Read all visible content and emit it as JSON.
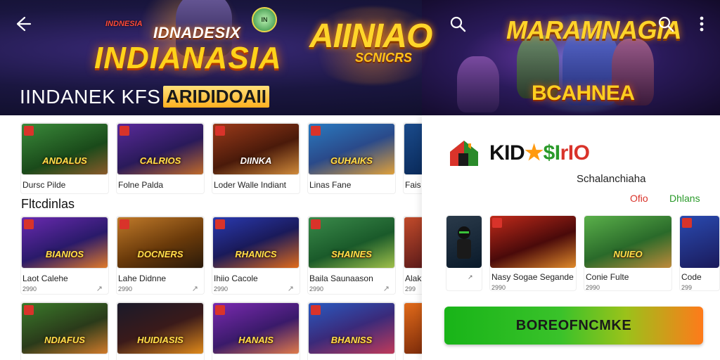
{
  "banner": {
    "logo_small": "INDNESIA",
    "logo_badge": "IN",
    "logo_top": "IDNADESIX",
    "logo_main": "INDIANASIA",
    "logo_aux_1": "AIINIAO",
    "logo_aux_2": "SCNICRS",
    "logo_right_1": "MARAMNAGIA",
    "logo_right_2": "BCAHNEA",
    "caption": "IINDANEK KFS",
    "caption_accent": "ARIDIDOAII"
  },
  "grid": {
    "row1": [
      {
        "thumb": "ANDALUS",
        "label": "Dursc Pilde",
        "sub": ""
      },
      {
        "thumb": "CALRIOS",
        "label": "Folne Palda",
        "sub": ""
      },
      {
        "thumb": "DIINKA",
        "label": "Loder Walle Indiant",
        "sub": ""
      },
      {
        "thumb": "GUHAIKS",
        "label": "Linas Fane",
        "sub": ""
      },
      {
        "thumb": "",
        "label": "Fais",
        "sub": ""
      }
    ],
    "section_title": "Fltcdinlas",
    "row2": [
      {
        "thumb": "BIANIOS",
        "label": "Laot Calehe",
        "sub": "2990"
      },
      {
        "thumb": "DOCNERS",
        "label": "Lahe Didnne",
        "sub": "2990"
      },
      {
        "thumb": "RHANICS",
        "label": "Ihiio Cacole",
        "sub": "2990"
      },
      {
        "thumb": "SHAINES",
        "label": "Baila Saunaason",
        "sub": "2990"
      },
      {
        "thumb": "",
        "label": "Alak",
        "sub": "299"
      }
    ],
    "row3": [
      {
        "thumb": "NDIAFUS",
        "label": "",
        "sub": ""
      },
      {
        "thumb": "HUIDIASIS",
        "label": "",
        "sub": ""
      },
      {
        "thumb": "HANAIS",
        "label": "",
        "sub": ""
      },
      {
        "thumb": "BHANISS",
        "label": "",
        "sub": ""
      },
      {
        "thumb": "",
        "label": "",
        "sub": ""
      }
    ],
    "card_icon": "↗"
  },
  "panel": {
    "title_1": "KID",
    "title_star": "★",
    "title_dollar": "$I",
    "title_rest": "rIO",
    "subtitle": "Schalanchiaha",
    "tab_a": "Ofio",
    "tab_b": "Dhlans",
    "cards": [
      {
        "thumb": "",
        "label": "",
        "sub": "↗"
      },
      {
        "thumb": "",
        "label": "Nasy Sogae Segande",
        "sub": "2990"
      },
      {
        "thumb": "NUIEO",
        "label": "Conie Fulte",
        "sub": "2990"
      },
      {
        "thumb": "",
        "label": "Code",
        "sub": "299"
      }
    ],
    "cta_label": "BOREOFNCMKE"
  }
}
